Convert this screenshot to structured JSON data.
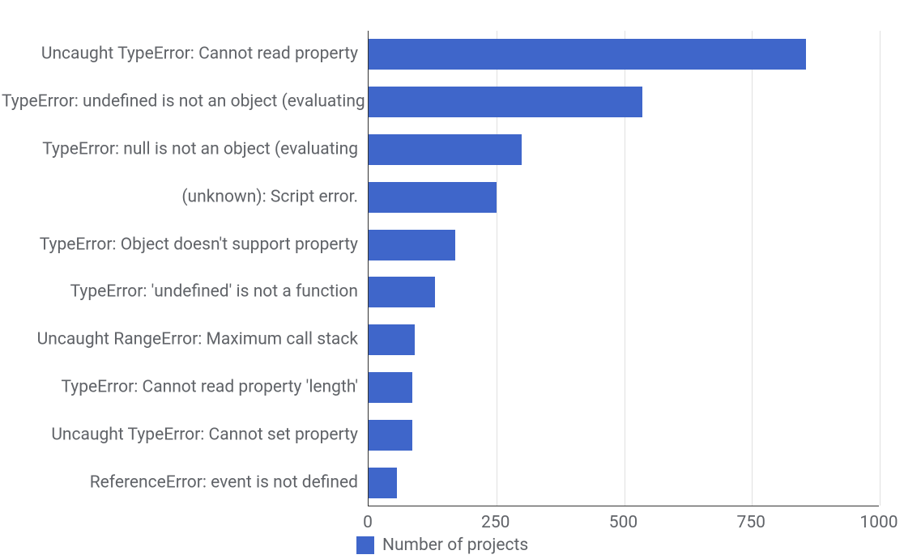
{
  "chart_data": {
    "type": "bar",
    "orientation": "horizontal",
    "categories": [
      "Uncaught TypeError: Cannot read property",
      "TypeError: undefined is not an object (evaluating",
      "TypeError: null is not an object (evaluating",
      "(unknown): Script error.",
      "TypeError: Object doesn't support property",
      "TypeError: 'undefined' is not a function",
      "Uncaught RangeError: Maximum call stack",
      "TypeError: Cannot read property 'length'",
      "Uncaught TypeError: Cannot set property",
      "ReferenceError: event is not defined"
    ],
    "values": [
      855,
      535,
      300,
      250,
      170,
      130,
      90,
      85,
      85,
      55
    ],
    "title": "",
    "xlabel": "",
    "ylabel": "",
    "xlim": [
      0,
      1000
    ],
    "x_ticks": [
      0,
      250,
      500,
      750,
      1000
    ],
    "legend": {
      "label": "Number of projects",
      "color": "#3f66ca"
    },
    "grid": true
  }
}
